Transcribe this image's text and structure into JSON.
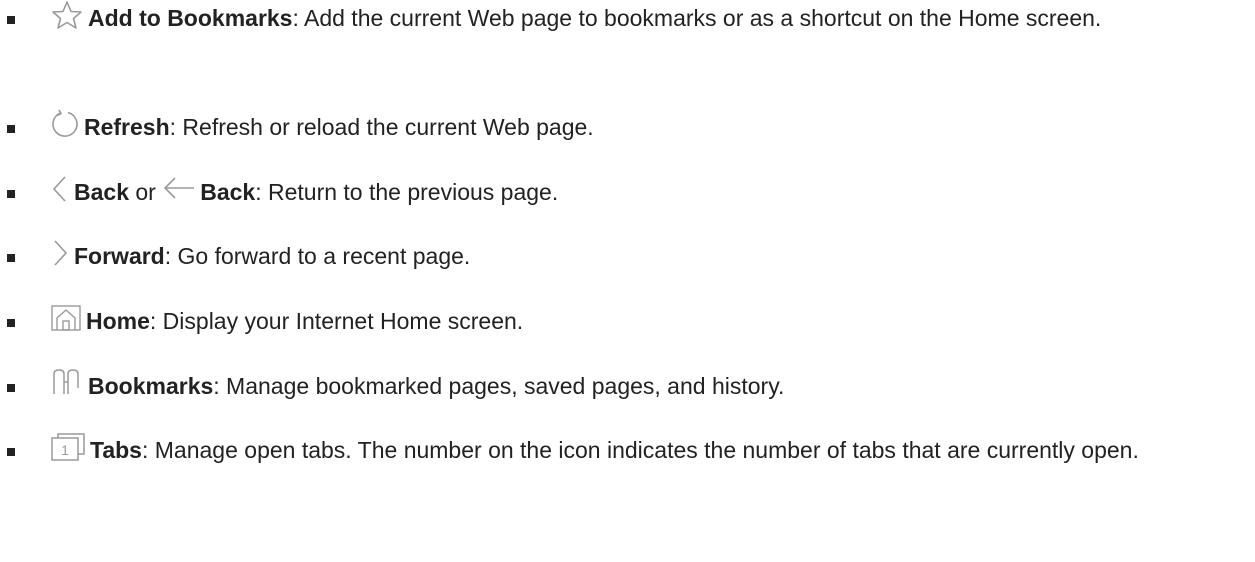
{
  "items": [
    {
      "icon": "star-outline-icon",
      "label": "Add to Bookmarks",
      "description": ": Add the current Web page to bookmarks or as a shortcut on the Home screen."
    },
    {
      "icon": "refresh-icon",
      "label": "Refresh",
      "description": ": Refresh or reload the current Web page."
    },
    {
      "icon": "chevron-left-icon",
      "label": "Back",
      "connector": " or ",
      "icon2": "arrow-left-icon",
      "label2": "Back",
      "description": ": Return to the previous page."
    },
    {
      "icon": "chevron-right-icon",
      "label": "Forward",
      "description": ": Go forward to a recent page."
    },
    {
      "icon": "home-icon",
      "label": "Home",
      "description": ": Display your Internet Home screen."
    },
    {
      "icon": "bookmarks-book-icon",
      "label": "Bookmarks",
      "description": ": Manage bookmarked pages, saved pages, and history."
    },
    {
      "icon": "tabs-icon",
      "tabs_count": "1",
      "label": "Tabs",
      "description": ": Manage open tabs. The number on the icon indicates the number of tabs that are currently open."
    }
  ],
  "colors": {
    "text": "#222222",
    "icon": "#9a9a9a"
  }
}
